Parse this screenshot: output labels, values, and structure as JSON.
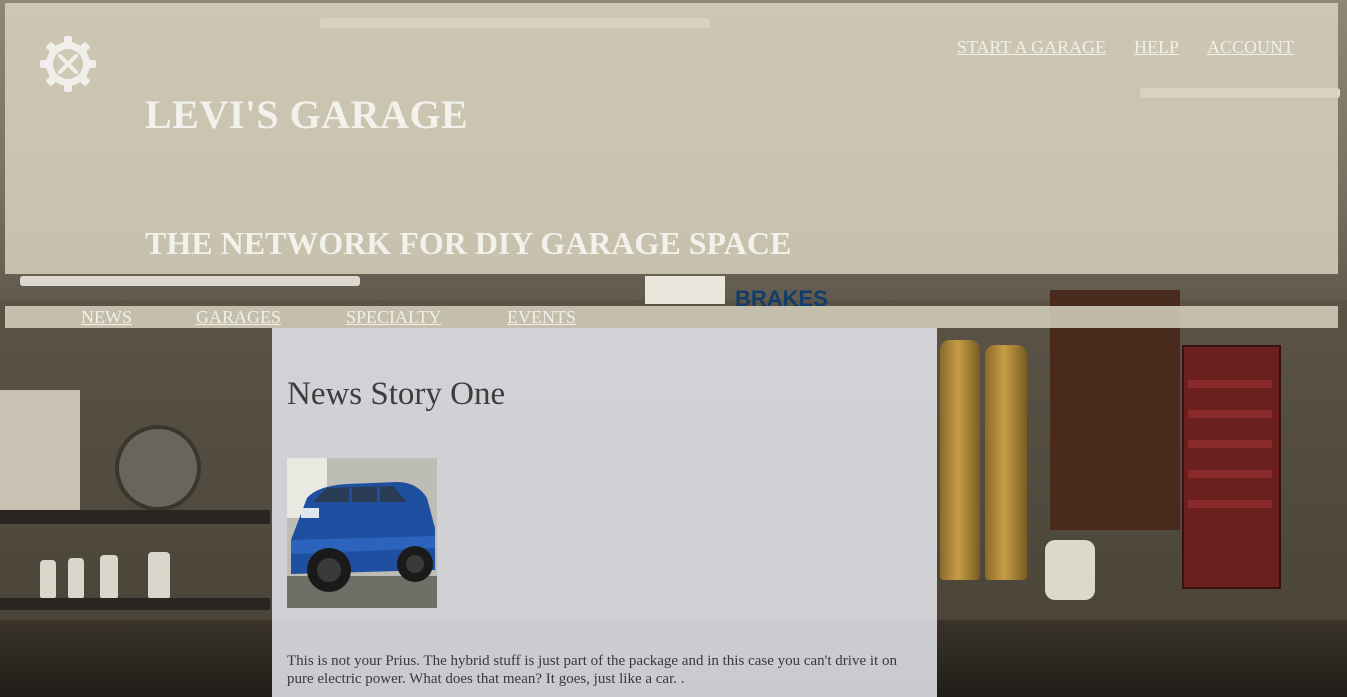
{
  "header": {
    "title": "LEVI'S GARAGE",
    "tagline": "THE NETWORK FOR DIY GARAGE SPACE",
    "logo_icon": "gear-tools-icon"
  },
  "top_nav": {
    "items": [
      "START A GARAGE",
      "HELP",
      "ACCOUNT"
    ]
  },
  "section_nav": {
    "items": [
      "NEWS",
      "GARAGES",
      "SPECIALTY",
      "EVENTS"
    ]
  },
  "article": {
    "title": "News Story One",
    "image_icon": "blue-suv-photo",
    "body": "This is not your Prius. The hybrid stuff is just part of the package and in this case you can't drive it on pure electric power. What does that mean? It goes, just like a car. ."
  },
  "colors": {
    "header_overlay": "#d6d0bd",
    "nav_text": "#f1efea",
    "article_panel": "#e8e8f0",
    "car_blue": "#1f4fa0"
  }
}
